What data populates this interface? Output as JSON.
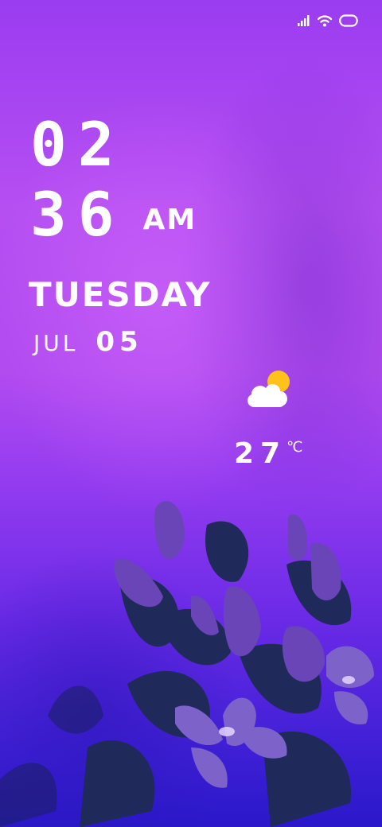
{
  "status_bar": {
    "icons": [
      "signal-icon",
      "wifi-icon",
      "battery-icon"
    ]
  },
  "clock": {
    "hour": "02",
    "minute": "36",
    "ampm": "AM"
  },
  "date": {
    "weekday": "TUESDAY",
    "month": "JUL",
    "day": "05"
  },
  "weather": {
    "icon": "partly-cloudy-icon",
    "temperature": "27",
    "unit": "℃"
  },
  "colors": {
    "background_top": "#9a3cf0",
    "background_bottom": "#2a18c9",
    "sun": "#ffc21a",
    "text": "#ffffff"
  }
}
